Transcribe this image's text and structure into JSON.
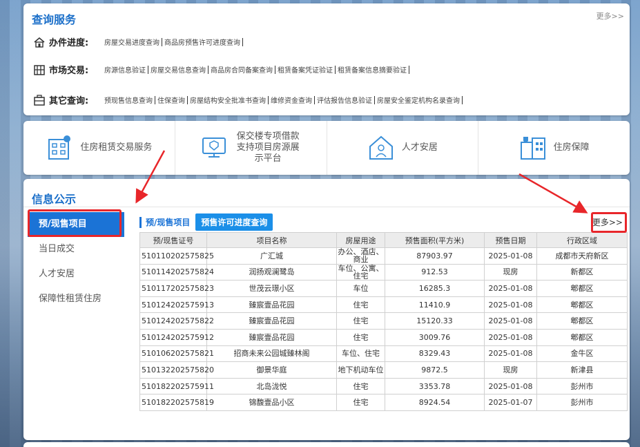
{
  "query": {
    "title": "查询服务",
    "more": "更多>>",
    "rows": [
      {
        "label": "办件进度:",
        "icon": "home-icon",
        "links": [
          "房屋交易进度查询",
          "商品房预售许可进度查询"
        ]
      },
      {
        "label": "市场交易:",
        "icon": "building-icon",
        "links": [
          "房源信息验证",
          "房屋交易信息查询",
          "商品房合同备案查询",
          "租赁备案凭证验证",
          "租赁备案信息摘要验证"
        ]
      },
      {
        "label": "其它查询:",
        "icon": "box-icon",
        "links": [
          "预现售信息查询",
          "住保查询",
          "房屋结构安全批准书查询",
          "维修资金查询",
          "评估报告信息验证",
          "房屋安全鉴定机构名录查询"
        ]
      }
    ]
  },
  "services": [
    {
      "label": "住房租赁交易服务",
      "icon": "rental-building-icon"
    },
    {
      "label": "保交楼专项借款支持项目房源展示平台",
      "icon": "monitor-icon"
    },
    {
      "label": "人才安居",
      "icon": "talent-house-icon"
    },
    {
      "label": "住房保障",
      "icon": "housing-security-icon"
    }
  ],
  "info": {
    "title": "信息公示",
    "menu": [
      "预/现售项目",
      "当日成交",
      "人才安居",
      "保障性租赁住房"
    ],
    "tab1": "预/现售项目",
    "tab2": "预售许可进度查询",
    "more": "更多>>",
    "columns": [
      "预/现售证号",
      "项目名称",
      "房屋用途",
      "预售面积(平方米)",
      "预售日期",
      "行政区域"
    ],
    "rows": [
      [
        "510110202575825",
        "广汇城",
        "办公、酒店、商业",
        "87903.97",
        "2025-01-08",
        "成都市天府新区"
      ],
      [
        "510114202575824",
        "润扬观澜鹭岛",
        "车位、公寓、住宅",
        "912.53",
        "现房",
        "新都区"
      ],
      [
        "510117202575823",
        "世茂云璟小区",
        "车位",
        "16285.3",
        "2025-01-08",
        "郫都区"
      ],
      [
        "510124202575913",
        "臻宸壹品花园",
        "住宅",
        "11410.9",
        "2025-01-08",
        "郫都区"
      ],
      [
        "510124202575822",
        "臻宸壹品花园",
        "住宅",
        "15120.33",
        "2025-01-08",
        "郫都区"
      ],
      [
        "510124202575912",
        "臻宸壹品花园",
        "住宅",
        "3009.76",
        "2025-01-08",
        "郫都区"
      ],
      [
        "510106202575821",
        "招商未来公园城臻林阁",
        "车位、住宅",
        "8329.43",
        "2025-01-08",
        "金牛区"
      ],
      [
        "510132202575820",
        "御景华庭",
        "地下机动车位",
        "9872.5",
        "现房",
        "新津县"
      ],
      [
        "510182202575911",
        "北岛泷悦",
        "住宅",
        "3353.78",
        "2025-01-08",
        "彭州市"
      ],
      [
        "510182202575819",
        "锦馥壹品小区",
        "住宅",
        "8924.54",
        "2025-01-07",
        "彭州市"
      ]
    ]
  },
  "colors": {
    "brand": "#1b6fc9",
    "active": "#1b73d6",
    "annotation": "#e8262a"
  }
}
